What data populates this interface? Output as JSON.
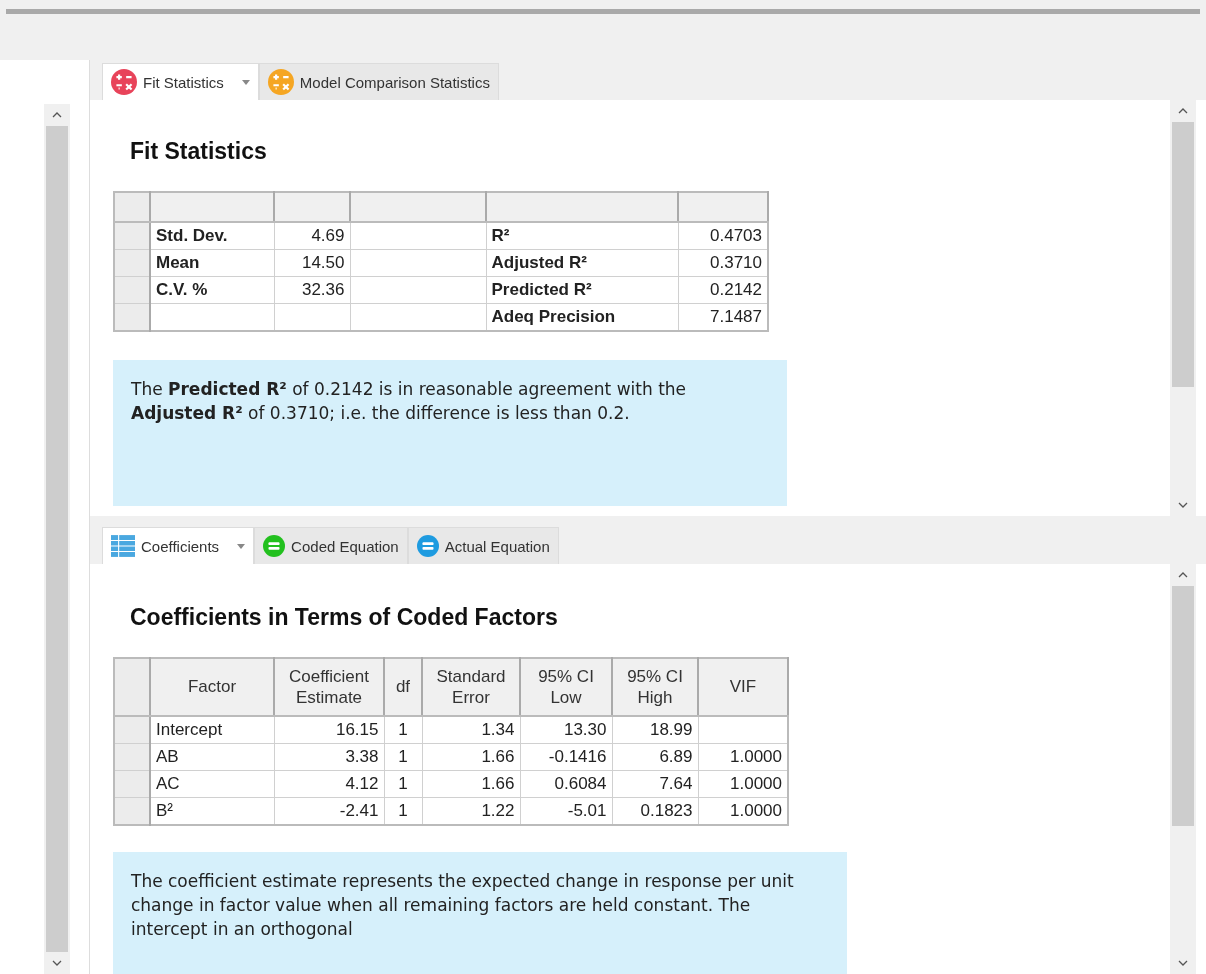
{
  "top_pane": {
    "tabs": [
      {
        "label": "Fit Statistics",
        "selected": true,
        "kind": "calc",
        "color": "#e8435a",
        "has_menu": true
      },
      {
        "label": "Model Comparison Statistics",
        "selected": false,
        "kind": "calc",
        "color": "#f5a623",
        "has_menu": false
      }
    ],
    "title": "Fit Statistics",
    "table": {
      "rows": [
        {
          "label_1": "Std. Dev.",
          "value_1": "4.69",
          "label_2": "R²",
          "value_2": "0.4703"
        },
        {
          "label_1": "Mean",
          "value_1": "14.50",
          "label_2": "Adjusted R²",
          "value_2": "0.3710"
        },
        {
          "label_1": "C.V. %",
          "value_1": "32.36",
          "label_2": "Predicted R²",
          "value_2": "0.2142"
        },
        {
          "label_2": "Adeq Precision",
          "value_2": "7.1487"
        }
      ]
    },
    "note": "The **Predicted R²** of 0.2142 is in reasonable agreement with the **Adjusted R²** of 0.3710; i.e. the difference is less than 0.2."
  },
  "bottom_pane": {
    "tabs": [
      {
        "label": "Coefficients",
        "selected": true,
        "kind": "table",
        "color": "#4aa8e0",
        "has_menu": true
      },
      {
        "label": "Coded Equation",
        "selected": false,
        "kind": "equals",
        "color": "#22c01e",
        "has_menu": false
      },
      {
        "label": "Actual Equation",
        "selected": false,
        "kind": "equals",
        "color": "#1e9be0",
        "has_menu": false
      }
    ],
    "title": "Coefficients in Terms of Coded Factors",
    "table": {
      "columns": [
        "Factor",
        "Coefficient Estimate",
        "df",
        "Standard Error",
        "95% CI Low",
        "95% CI High",
        "VIF"
      ],
      "rows": [
        [
          "Intercept",
          "16.15",
          "1",
          "1.34",
          "13.30",
          "18.99"
        ],
        [
          "AB",
          "3.38",
          "1",
          "1.66",
          "-0.1416",
          "6.89",
          "1.0000"
        ],
        [
          "AC",
          "4.12",
          "1",
          "1.66",
          "0.6084",
          "7.64",
          "1.0000"
        ],
        [
          "B²",
          "-2.41",
          "1",
          "1.22",
          "-5.01",
          "0.1823",
          "1.0000"
        ]
      ]
    },
    "note": "The coefficient estimate represents the expected change in response per unit change in factor value when all remaining factors are held constant. The intercept in an orthogonal"
  }
}
